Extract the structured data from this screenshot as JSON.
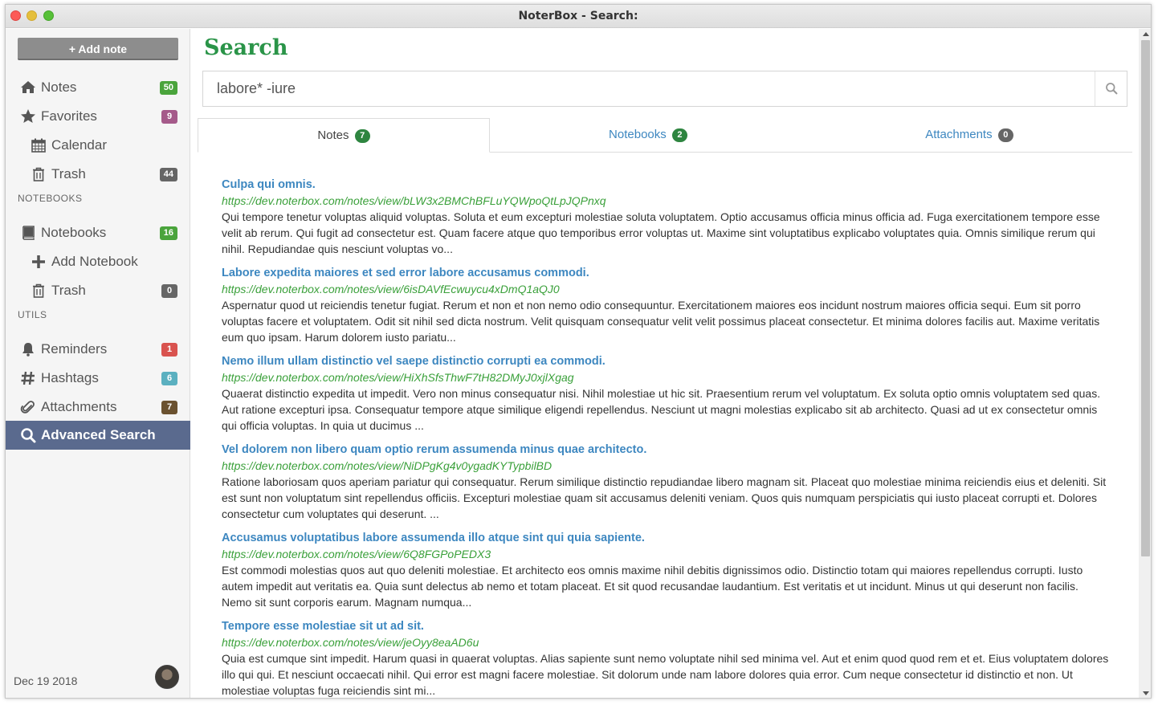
{
  "window": {
    "title": "NoterBox - Search:"
  },
  "sidebar": {
    "add_note_label": "+ Add note",
    "items": [
      {
        "label": "Notes",
        "badge": "50",
        "badge_color": "#4aa43c",
        "icon": "home-icon"
      },
      {
        "label": "Favorites",
        "badge": "9",
        "badge_color": "#a55a8a",
        "icon": "star-icon"
      },
      {
        "label": "Calendar",
        "badge": "",
        "icon": "calendar-icon"
      },
      {
        "label": "Trash",
        "badge": "44",
        "badge_color": "#666666",
        "icon": "trash-icon"
      }
    ],
    "notebooks_heading": "NOTEBOOKS",
    "notebook_items": [
      {
        "label": "Notebooks",
        "badge": "16",
        "badge_color": "#4aa43c",
        "icon": "book-icon"
      },
      {
        "label": "Add Notebook",
        "badge": "",
        "icon": "plus-icon"
      },
      {
        "label": "Trash",
        "badge": "0",
        "badge_color": "#666666",
        "icon": "trash-icon"
      }
    ],
    "utils_heading": "UTILS",
    "util_items": [
      {
        "label": "Reminders",
        "badge": "1",
        "badge_color": "#d9534f",
        "icon": "bell-icon"
      },
      {
        "label": "Hashtags",
        "badge": "6",
        "badge_color": "#5bb0c0",
        "icon": "hashtag-icon"
      },
      {
        "label": "Attachments",
        "badge": "7",
        "badge_color": "#6b5230",
        "icon": "paperclip-icon"
      },
      {
        "label": "Advanced Search",
        "badge": "",
        "icon": "search-icon",
        "active": true
      }
    ],
    "footer_date": "Dec 19 2018"
  },
  "main": {
    "title": "Search",
    "search_value": "labore* -iure",
    "tabs": [
      {
        "label": "Notes",
        "count": "7",
        "count_color": "#2e8540",
        "active": true
      },
      {
        "label": "Notebooks",
        "count": "2",
        "count_color": "#2e8540"
      },
      {
        "label": "Attachments",
        "count": "0",
        "count_color": "#666666"
      }
    ],
    "results": [
      {
        "title": "Culpa qui omnis.",
        "url": "https://dev.noterbox.com/notes/view/bLW3x2BMChBFLuYQWpoQtLpJQPnxq",
        "text": "Qui tempore tenetur voluptas aliquid voluptas. Soluta et eum excepturi molestiae soluta voluptatem. Optio accusamus officia minus officia ad. Fuga exercitationem tempore esse velit ab rerum. Qui fugit ad consectetur est. Quam facere atque quo temporibus error voluptas ut. Maxime sint voluptatibus explicabo voluptates quia. Omnis similique rerum qui nihil. Repudiandae quis nesciunt voluptas vo..."
      },
      {
        "title": "Labore expedita maiores et sed error labore accusamus commodi.",
        "url": "https://dev.noterbox.com/notes/view/6isDAVfEcwuycu4xDmQ1aQJ0",
        "text": "Aspernatur quod ut reiciendis tenetur fugiat. Rerum et non et non nemo odio consequuntur. Exercitationem maiores eos incidunt nostrum maiores officia sequi. Eum sit porro voluptas facere et voluptatem. Odit sit nihil sed dicta nostrum. Velit quisquam consequatur velit velit possimus placeat consectetur. Et minima dolores facilis aut. Maxime veritatis eum quo ipsam. Harum dolorem iusto pariatu..."
      },
      {
        "title": "Nemo illum ullam distinctio vel saepe distinctio corrupti ea commodi.",
        "url": "https://dev.noterbox.com/notes/view/HiXhSfsThwF7tH82DMyJ0xjlXgag",
        "text": "Quaerat distinctio expedita ut impedit. Vero non minus consequatur nisi. Nihil molestiae ut hic sit. Praesentium rerum vel voluptatum. Ex soluta optio omnis voluptatem sed quas. Aut ratione excepturi ipsa. Consequatur tempore atque similique eligendi repellendus. Nesciunt ut magni molestias explicabo sit ab architecto. Quasi ad ut ex consectetur omnis qui officia voluptas. In quia ut ducimus ..."
      },
      {
        "title": "Vel dolorem non libero quam optio rerum assumenda minus quae architecto.",
        "url": "https://dev.noterbox.com/notes/view/NiDPgKg4v0ygadKYTypbilBD",
        "text": "Ratione laboriosam quos aperiam pariatur qui consequatur. Rerum similique distinctio repudiandae libero magnam sit. Placeat quo molestiae minima reiciendis eius et deleniti. Sit est sunt non voluptatum sint repellendus officiis. Excepturi molestiae quam sit accusamus deleniti veniam. Quos quis numquam perspiciatis qui iusto placeat corrupti et. Dolores consectetur cum voluptates qui deserunt. ..."
      },
      {
        "title": "Accusamus voluptatibus labore assumenda illo atque sint qui quia sapiente.",
        "url": "https://dev.noterbox.com/notes/view/6Q8FGPoPEDX3",
        "text": "Est commodi molestias quos aut quo deleniti molestiae. Et architecto eos omnis maxime nihil debitis dignissimos odio. Distinctio totam qui maiores repellendus corrupti. Iusto autem impedit aut veritatis ea. Quia sunt delectus ab nemo et totam placeat. Et sit quod recusandae laudantium. Est veritatis et ut incidunt. Minus ut qui deserunt non facilis. Nemo sit sunt corporis earum. Magnam numqua..."
      },
      {
        "title": "Tempore esse molestiae sit ut ad sit.",
        "url": "https://dev.noterbox.com/notes/view/jeOyy8eaAD6u",
        "text": "Quia est cumque sint impedit. Harum quasi in quaerat voluptas. Alias sapiente sunt nemo voluptate nihil sed minima vel. Aut et enim quod quod rem et et. Eius voluptatem dolores illo qui qui. Et nesciunt occaecati nihil. Qui error est magni facere molestiae. Sit dolorum unde nam labore dolores quia error. Cum neque consectetur id distinctio et non. Ut molestiae voluptas fuga reiciendis sint mi..."
      }
    ]
  }
}
